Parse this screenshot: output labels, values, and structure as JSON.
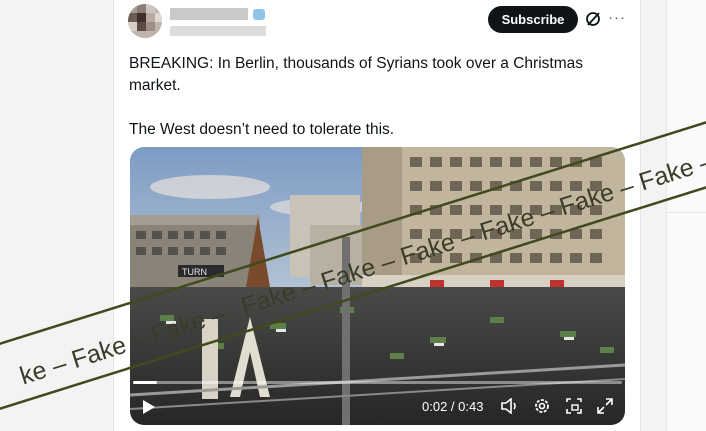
{
  "header": {
    "subscribe_label": "Subscribe",
    "more_label": "···",
    "grok_icon": "slash-circle-icon"
  },
  "tweet": {
    "line1": "BREAKING: In Berlin, thousands of Syrians took over a Christmas market.",
    "line2": "The West doesn’t need to tolerate this."
  },
  "video": {
    "time_display": "0:02 / 0:43",
    "progress_fraction": 0.05,
    "sign_text": "TURN"
  },
  "overlay": {
    "upper_band_text": "Fake – Fake – Fake – Fake – Fake – Fake – Fake",
    "lower_band_text": "ke – Fake – Fake –"
  },
  "colors": {
    "button_bg": "#0f1419",
    "band_line": "#3f4a1e",
    "band_text": "#3b3b2a"
  }
}
